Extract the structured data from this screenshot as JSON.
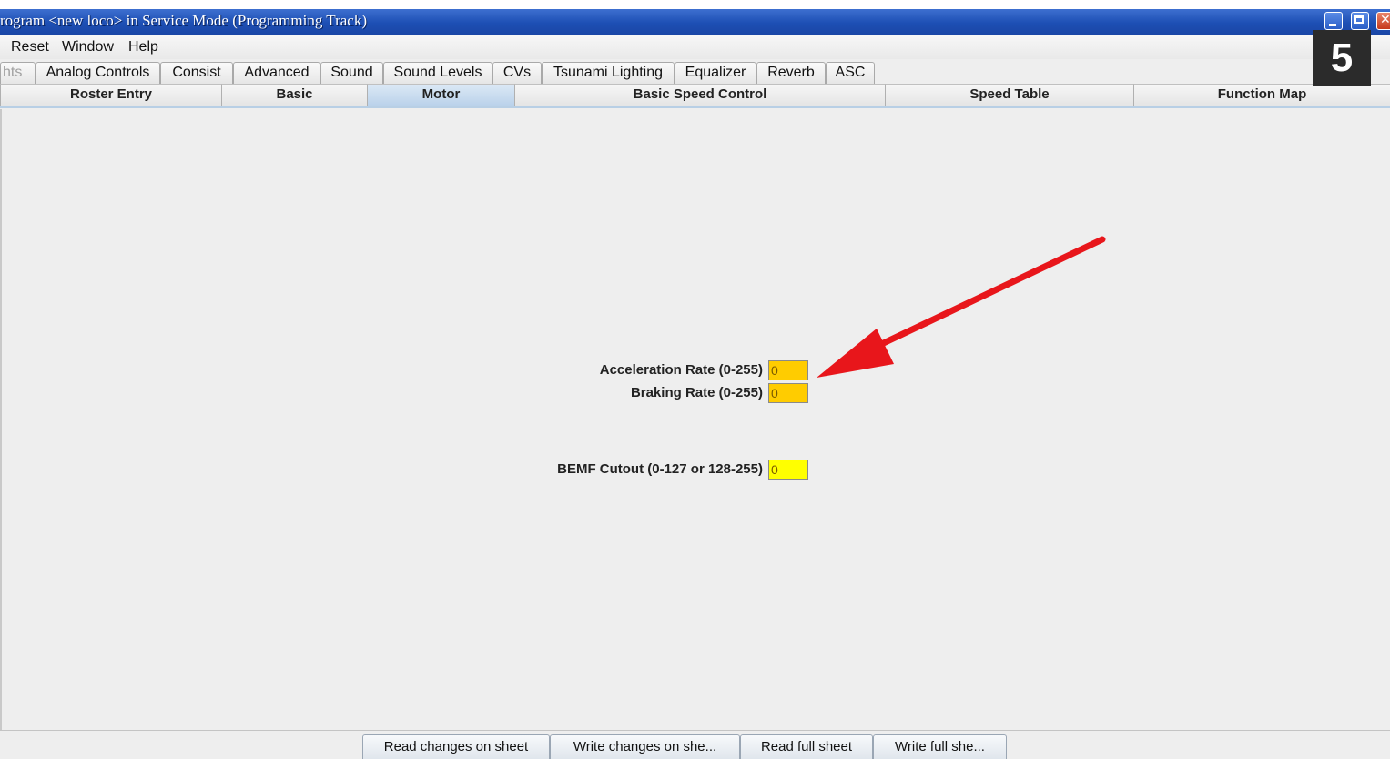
{
  "window": {
    "title": "rogram <new loco> in Service Mode (Programming Track)"
  },
  "menu": [
    "Reset",
    "Window",
    "Help"
  ],
  "badge": "5",
  "tabs_row1": [
    "hts",
    "Analog Controls",
    "Consist",
    "Advanced",
    "Sound",
    "Sound Levels",
    "CVs",
    "Tsunami Lighting",
    "Equalizer",
    "Reverb",
    "ASC"
  ],
  "tabs_row2": [
    "Roster Entry",
    "Basic",
    "Motor",
    "Basic Speed Control",
    "Speed Table",
    "Function Map"
  ],
  "active_tab": "Motor",
  "fields": [
    {
      "label": "Acceleration Rate (0-255)",
      "value": "0",
      "color": "#ffcc00"
    },
    {
      "label": "Braking Rate (0-255)",
      "value": "0",
      "color": "#ffcc00"
    },
    {
      "label": "BEMF Cutout (0-127 or 128-255)",
      "value": "0",
      "color": "#ffff00"
    }
  ],
  "buttons": [
    "Read changes on sheet",
    "Write changes on she...",
    "Read full sheet",
    "Write full she..."
  ],
  "colors": {
    "accent_arrow": "#e8161b",
    "active_tab": "#c5d9ee"
  }
}
